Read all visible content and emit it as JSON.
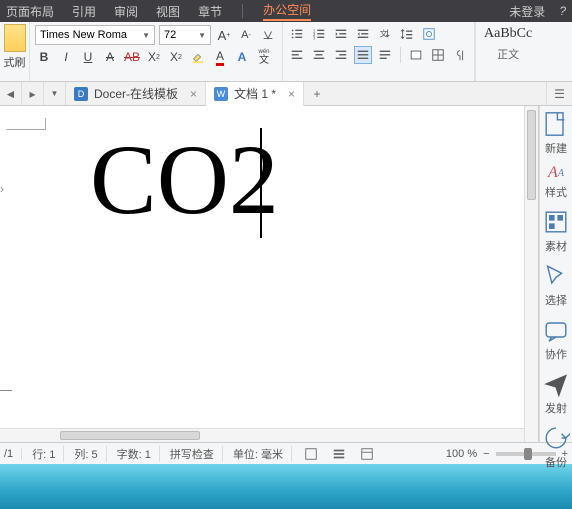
{
  "menubar": {
    "items": [
      "页面布局",
      "引用",
      "审阅",
      "视图",
      "章节"
    ],
    "workspace": "办公空间",
    "login": "未登录",
    "help_title": "帮助"
  },
  "ribbon": {
    "brush_label": "式刷",
    "font_name": "Times New Roma",
    "font_size": "72",
    "styles_preview": "AaBbCc",
    "styles_label": "正文"
  },
  "tabs": {
    "docer": "Docer-在线模板",
    "doc": "文档 1 *"
  },
  "document": {
    "text": "CO2"
  },
  "sidebar": {
    "items": [
      {
        "label": "新建"
      },
      {
        "label": "样式"
      },
      {
        "label": "素材"
      },
      {
        "label": "选择"
      },
      {
        "label": "协作"
      },
      {
        "label": "发射"
      },
      {
        "label": "备份"
      }
    ]
  },
  "status": {
    "page": "/1",
    "line": "行: 1",
    "col": "列: 5",
    "chars": "字数: 1",
    "spell": "拼写检查",
    "unit": "单位: 毫米",
    "zoom": "100 %"
  }
}
